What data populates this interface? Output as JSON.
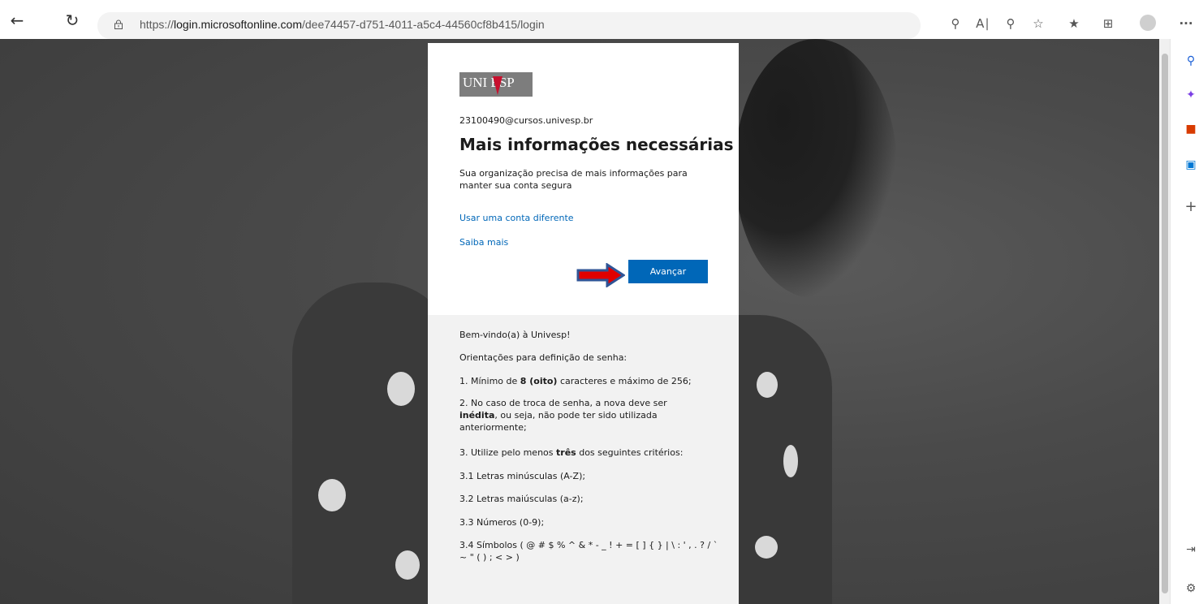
{
  "browser": {
    "url_prefix": "https://",
    "url_host": "login.microsoftonline.com",
    "url_path": "/dee74457-d751-4011-a5c4-44560cf8b415/login",
    "more_menu": "···"
  },
  "card": {
    "logo_text": "UNI ESP",
    "email": "23100490@cursos.univesp.br",
    "title": "Mais informações necessárias",
    "description": "Sua organização precisa de mais informações para manter sua conta segura",
    "link_other_account": "Usar uma conta diferente",
    "link_learn_more": "Saiba mais",
    "next_button": "Avançar"
  },
  "banner": {
    "welcome": "Bem-vindo(a) à Univesp!",
    "guidelines_title": "Orientações para definição de senha:",
    "rule1_pre": "1. Mínimo de ",
    "rule1_bold": "8 (oito)",
    "rule1_post": " caracteres e máximo de 256;",
    "rule2_pre": "2. No caso de troca de senha, a nova deve ser ",
    "rule2_bold": "inédita",
    "rule2_post": ", ou seja, não pode ter sido utilizada anteriormente;",
    "rule3_pre": "3. Utilize pelo menos ",
    "rule3_bold": "três",
    "rule3_post": " dos seguintes critérios:",
    "rule31": "3.1 Letras minúsculas (A-Z);",
    "rule32": "3.2 Letras maiúsculas (a-z);",
    "rule33": "3.3 Números (0-9);",
    "rule34": "3.4 Símbolos ( @ # $ % ^ & * - _ ! + = [ ] { } | \\ : ' , . ? / ` ~ \" ( ) ; < > )"
  },
  "colors": {
    "accent": "#0067b8",
    "arrow_fill": "#e00000",
    "arrow_outline": "#2f5496"
  }
}
